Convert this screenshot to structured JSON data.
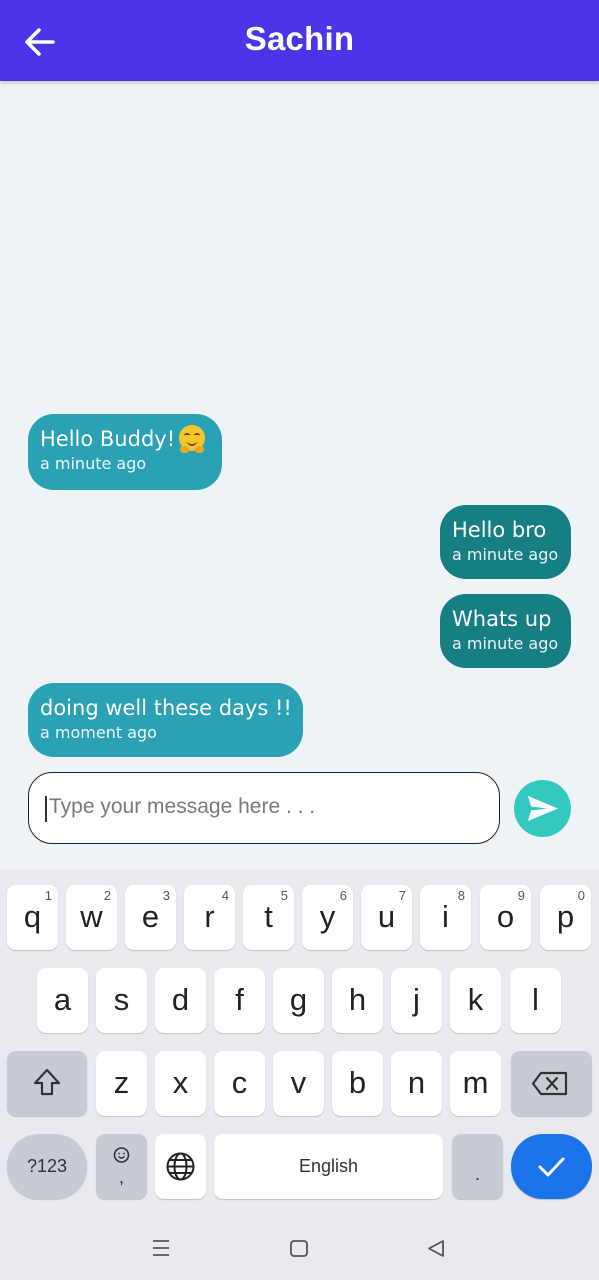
{
  "header": {
    "title": "Sachin",
    "back_icon": "arrow-left-icon"
  },
  "colors": {
    "appbar": "#4c35e8",
    "incoming_bubble": "#2aa1b4",
    "outgoing_bubble": "#167f84",
    "send_button": "#33c9c0",
    "keyboard_done": "#1a73e8"
  },
  "messages": [
    {
      "text": "Hello Buddy!",
      "emoji": "hugging-face-emoji",
      "time": "a minute ago",
      "direction": "incoming"
    },
    {
      "text": "Hello bro",
      "time": "a minute ago",
      "direction": "outgoing"
    },
    {
      "text": "Whats up",
      "time": "a minute ago",
      "direction": "outgoing"
    },
    {
      "text": "doing well these days !!",
      "time": "a moment ago",
      "direction": "incoming"
    }
  ],
  "composer": {
    "placeholder": "Type your message here . . .",
    "send_icon": "send-icon"
  },
  "keyboard": {
    "row1": [
      {
        "ch": "q",
        "num": "1"
      },
      {
        "ch": "w",
        "num": "2"
      },
      {
        "ch": "e",
        "num": "3"
      },
      {
        "ch": "r",
        "num": "4"
      },
      {
        "ch": "t",
        "num": "5"
      },
      {
        "ch": "y",
        "num": "6"
      },
      {
        "ch": "u",
        "num": "7"
      },
      {
        "ch": "i",
        "num": "8"
      },
      {
        "ch": "o",
        "num": "9"
      },
      {
        "ch": "p",
        "num": "0"
      }
    ],
    "row2": [
      "a",
      "s",
      "d",
      "f",
      "g",
      "h",
      "j",
      "k",
      "l"
    ],
    "row3": [
      "z",
      "x",
      "c",
      "v",
      "b",
      "n",
      "m"
    ],
    "symbols_label": "?123",
    "comma_label": ",",
    "space_label": "English",
    "period_label": ".",
    "shift_icon": "shift-icon",
    "backspace_icon": "backspace-icon",
    "emoji_icon": "emoji-icon",
    "globe_icon": "globe-icon",
    "done_icon": "checkmark-icon"
  },
  "navbar": {
    "icons": [
      "menu-icon",
      "home-square-icon",
      "back-triangle-icon"
    ]
  }
}
